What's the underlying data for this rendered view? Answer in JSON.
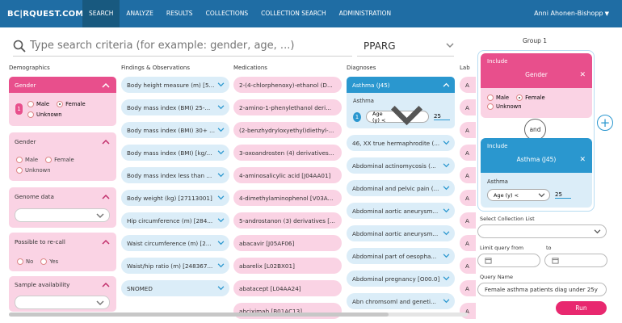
{
  "nav": {
    "logo": "BC|RQUEST.COM",
    "items": [
      "SEARCH",
      "ANALYZE",
      "RESULTS",
      "COLLECTIONS",
      "COLLECTION SEARCH",
      "ADMINISTRATION"
    ],
    "active": "SEARCH",
    "user": "Anni Ahonen-Bishopp"
  },
  "search": {
    "placeholder": "Type search criteria (for example: gender, age, ...)",
    "gene_value": "PPARG"
  },
  "columns": {
    "demographics": "Demographics",
    "findings": "Findings & Observations",
    "medications": "Medications",
    "diagnoses": "Diagnoses",
    "lab": "Lab"
  },
  "demographics": {
    "gender_active": {
      "title": "Gender",
      "badge": "1",
      "options": [
        "Male",
        "Female",
        "Unknown"
      ]
    },
    "gender": {
      "title": "Gender",
      "options": [
        "Male",
        "Female",
        "Unknown"
      ]
    },
    "genome": {
      "title": "Genome data"
    },
    "recall": {
      "title": "Possible to re-call",
      "options": [
        "No",
        "Yes"
      ]
    },
    "sample": {
      "title": "Sample availability"
    }
  },
  "findings": [
    "Body height measure (m) [5...",
    "Body mass index (BMI) 25-...",
    "Body mass index (BMI) 30+ ...",
    "Body mass index (BMI) [kg/...",
    "Body mass index less than ...",
    "Body weight (kg) [27113001]",
    "Hip circumference (m) [284...",
    "Waist circumference (m) [2...",
    "Waist/hip ratio (m) [248367...",
    "SNOMED"
  ],
  "medications": [
    "2-(4-chlorphenoxy)-ethanol (D...",
    "2-amino-1-phenylethanol deri...",
    "(2-benzhydryloxyethyl)diethyl-...",
    "3-oxoandrosten (4) derivatives...",
    "4-aminosalicylic acid [J04AA01]",
    "4-dimethylaminophenol [V03A...",
    "5-androstanon (3) derivatives [...",
    "abacavir [J05AF06]",
    "abarelix [L02BX01]",
    "abatacept [L04AA24]",
    "abciximab [B01AC13]"
  ],
  "diagnoses": {
    "active": {
      "title": "Asthma (J45)",
      "sub": "Asthma",
      "badge": "1",
      "select": "Age (y) <",
      "value": "25"
    },
    "items": [
      "46, XX true hermaphrodite (...",
      "Abdominal actinomycosis (...",
      "Abdominal and pelvic pain (...",
      "Abdominal aortic aneurysm...",
      "Abdominal aortic aneurysm...",
      "Abdominal part of oesopha...",
      "Abdominal pregnancy [O00.0]",
      "Abn chromsoml and geneti..."
    ]
  },
  "lab_items": [
    "A",
    "A",
    "A",
    "A",
    "A",
    "A",
    "A",
    "A",
    "A",
    "A",
    "A"
  ],
  "group": {
    "title": "Group 1",
    "include1": {
      "label": "Include",
      "title": "Gender",
      "options": [
        "Male",
        "Female",
        "Unknown"
      ]
    },
    "connector": "and",
    "include2": {
      "label": "Include",
      "title": "Asthma (J45)",
      "sub": "Asthma",
      "select": "Age (y) <",
      "value": "25"
    }
  },
  "form": {
    "collection_label": "Select Collection List",
    "limit_label": "Limit query from",
    "to_label": "to",
    "query_label": "Query Name",
    "query_value": "Female asthma patients diag under 25y",
    "run_label": "Run"
  },
  "colors": {
    "nav": "#1f6da4",
    "pink": "#e84f8c",
    "blue": "#2a97cf",
    "run": "#e8286f"
  }
}
